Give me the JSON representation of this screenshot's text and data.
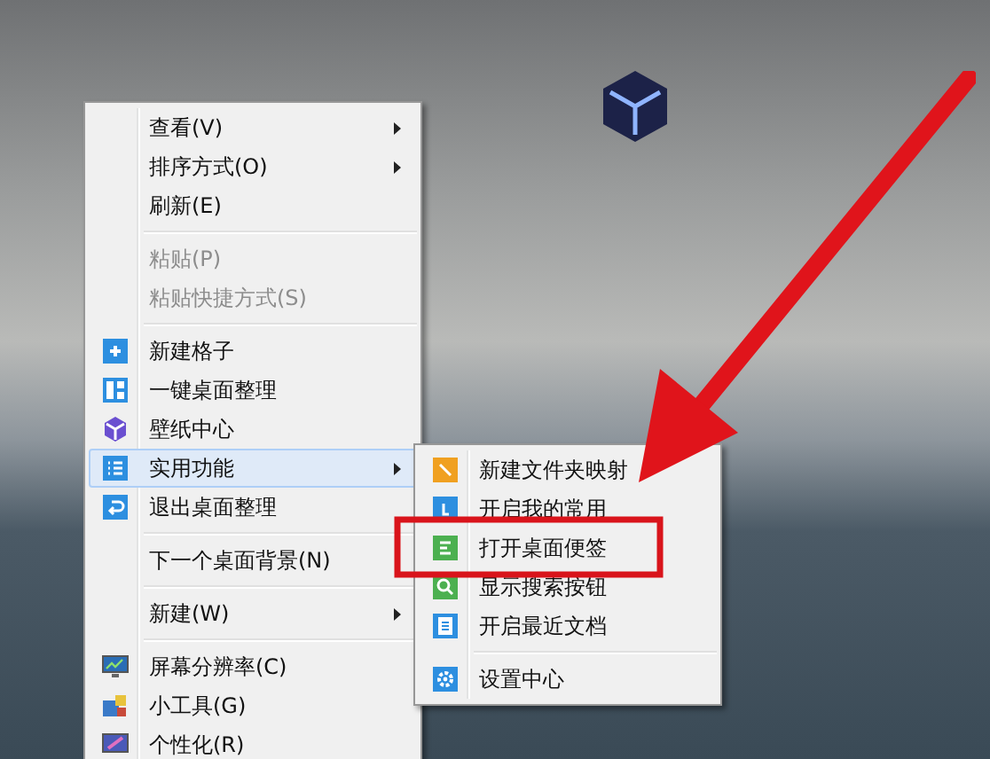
{
  "context_menu": {
    "items": [
      {
        "kind": "item",
        "label": "查看(V)",
        "submenu": true,
        "disabled": false,
        "selected": false
      },
      {
        "kind": "item",
        "label": "排序方式(O)",
        "submenu": true,
        "disabled": false,
        "selected": false
      },
      {
        "kind": "item",
        "label": "刷新(E)",
        "submenu": false,
        "disabled": false,
        "selected": false
      },
      {
        "kind": "separator"
      },
      {
        "kind": "item",
        "label": "粘贴(P)",
        "submenu": false,
        "disabled": true,
        "selected": false
      },
      {
        "kind": "item",
        "label": "粘贴快捷方式(S)",
        "submenu": false,
        "disabled": true,
        "selected": false
      },
      {
        "kind": "separator"
      },
      {
        "kind": "item",
        "label": "新建格子",
        "submenu": false,
        "disabled": false,
        "selected": false
      },
      {
        "kind": "item",
        "label": "一键桌面整理",
        "submenu": false,
        "disabled": false,
        "selected": false
      },
      {
        "kind": "item",
        "label": "壁纸中心",
        "submenu": false,
        "disabled": false,
        "selected": false
      },
      {
        "kind": "item",
        "label": "实用功能",
        "submenu": true,
        "disabled": false,
        "selected": true
      },
      {
        "kind": "item",
        "label": "退出桌面整理",
        "submenu": false,
        "disabled": false,
        "selected": false
      },
      {
        "kind": "separator"
      },
      {
        "kind": "item",
        "label": "下一个桌面背景(N)",
        "submenu": false,
        "disabled": false,
        "selected": false
      },
      {
        "kind": "separator"
      },
      {
        "kind": "item",
        "label": "新建(W)",
        "submenu": true,
        "disabled": false,
        "selected": false
      },
      {
        "kind": "separator"
      },
      {
        "kind": "item",
        "label": "屏幕分辨率(C)",
        "submenu": false,
        "disabled": false,
        "selected": false
      },
      {
        "kind": "item",
        "label": "小工具(G)",
        "submenu": false,
        "disabled": false,
        "selected": false
      },
      {
        "kind": "item",
        "label": "个性化(R)",
        "submenu": false,
        "disabled": false,
        "selected": false
      }
    ]
  },
  "submenu": {
    "items": [
      {
        "kind": "item",
        "label": "新建文件夹映射"
      },
      {
        "kind": "item",
        "label": "开启我的常用"
      },
      {
        "kind": "item",
        "label": "打开桌面便签"
      },
      {
        "kind": "item",
        "label": "显示搜索按钮"
      },
      {
        "kind": "item",
        "label": "开启最近文档"
      },
      {
        "kind": "separator"
      },
      {
        "kind": "item",
        "label": "设置中心"
      }
    ]
  }
}
